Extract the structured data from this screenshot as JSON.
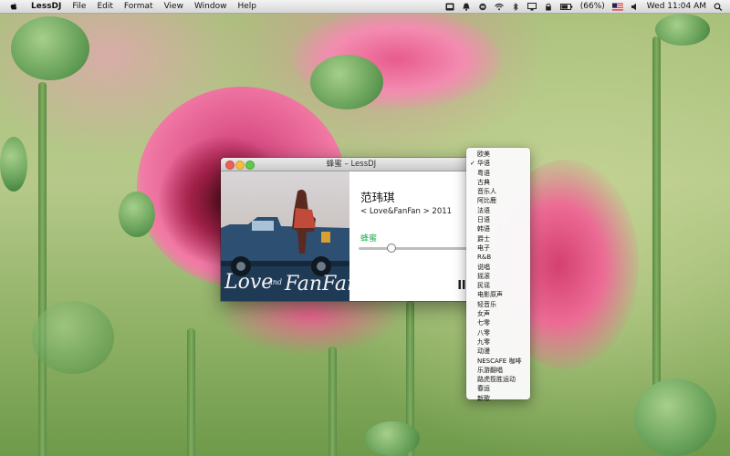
{
  "menubar": {
    "app_name": "LessDJ",
    "menus": [
      "File",
      "Edit",
      "Format",
      "View",
      "Window",
      "Help"
    ],
    "battery": "(66%)",
    "clock": "Wed 11:04 AM"
  },
  "window": {
    "title": "蜂蜜 – LessDJ",
    "artist": "范玮琪",
    "album": "< Love&FanFan > 2011",
    "song": "蜂蜜",
    "progress": 0.27
  },
  "channel_menu": {
    "items": [
      {
        "label": "欧美",
        "checked": false
      },
      {
        "label": "华语",
        "checked": true
      },
      {
        "label": "粤语",
        "checked": false
      },
      {
        "label": "古典",
        "checked": false
      },
      {
        "label": "音乐人",
        "checked": false
      },
      {
        "label": "阿比鹿",
        "checked": false
      },
      {
        "label": "法语",
        "checked": false
      },
      {
        "label": "日语",
        "checked": false
      },
      {
        "label": "韩语",
        "checked": false
      },
      {
        "label": "爵士",
        "checked": false
      },
      {
        "label": "电子",
        "checked": false
      },
      {
        "label": "R&B",
        "checked": false
      },
      {
        "label": "说唱",
        "checked": false
      },
      {
        "label": "摇滚",
        "checked": false
      },
      {
        "label": "民谣",
        "checked": false
      },
      {
        "label": "电影原声",
        "checked": false
      },
      {
        "label": "轻音乐",
        "checked": false
      },
      {
        "label": "女声",
        "checked": false
      },
      {
        "label": "七零",
        "checked": false
      },
      {
        "label": "八零",
        "checked": false
      },
      {
        "label": "九零",
        "checked": false
      },
      {
        "label": "动漫",
        "checked": false
      },
      {
        "label": "NESCAFE 咖啡",
        "checked": false
      },
      {
        "label": "乐游翻唱",
        "checked": false
      },
      {
        "label": "路虎揽胜运动",
        "checked": false
      },
      {
        "label": "春运",
        "checked": false
      },
      {
        "label": "新歌",
        "checked": false
      }
    ]
  },
  "colors": {
    "song_green": "#1ab34d",
    "menu_bg": "#fafafa"
  }
}
